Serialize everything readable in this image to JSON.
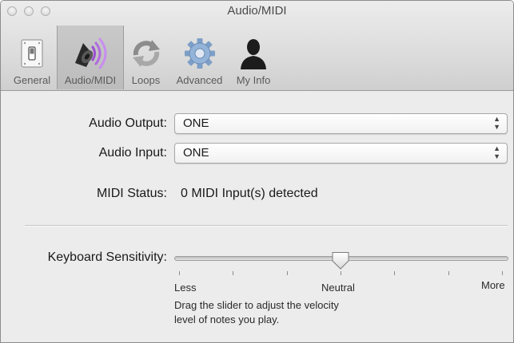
{
  "window": {
    "title": "Audio/MIDI"
  },
  "toolbar": {
    "items": [
      {
        "label": "General",
        "icon": "switch-icon",
        "active": false
      },
      {
        "label": "Audio/MIDI",
        "icon": "speaker-icon",
        "active": true
      },
      {
        "label": "Loops",
        "icon": "loops-icon",
        "active": false
      },
      {
        "label": "Advanced",
        "icon": "gear-icon",
        "active": false
      },
      {
        "label": "My Info",
        "icon": "person-icon",
        "active": false
      }
    ]
  },
  "audio": {
    "output_label": "Audio Output:",
    "output_value": "ONE",
    "input_label": "Audio Input:",
    "input_value": "ONE",
    "midi_label": "MIDI Status:",
    "midi_value": "0 MIDI Input(s) detected"
  },
  "keyboard": {
    "label": "Keyboard Sensitivity:",
    "slider_value": 0.5,
    "min_label": "Less",
    "mid_label": "Neutral",
    "max_label": "More",
    "hint_line1": "Drag the slider to adjust the velocity",
    "hint_line2": "level of notes you play."
  },
  "colors": {
    "accent_purple": "#9a4fd0",
    "window_bg": "#ececec"
  }
}
